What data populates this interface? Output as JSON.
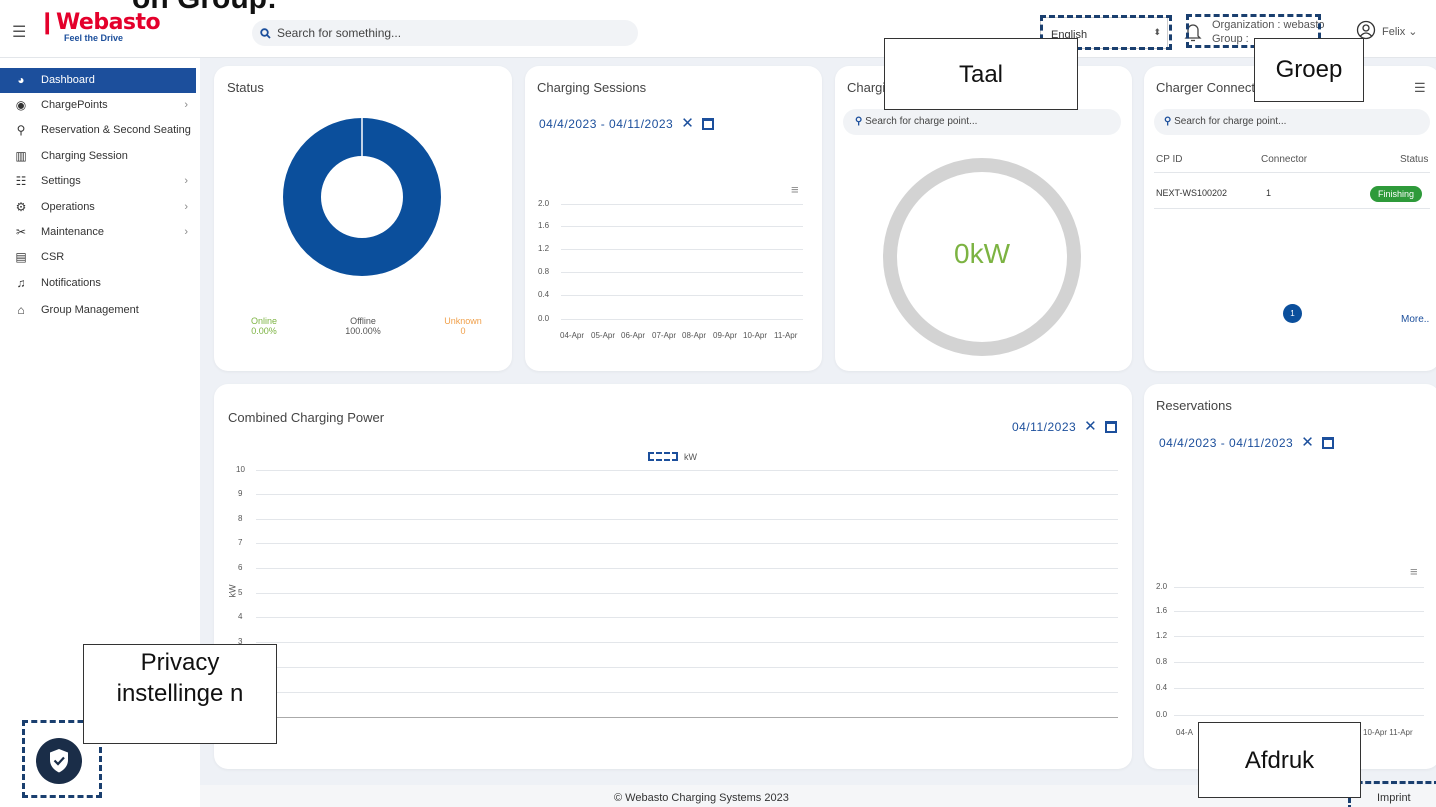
{
  "header": {
    "overlay_title": "on Group:",
    "logo_text": "Webasto",
    "logo_tagline": "Feel the Drive",
    "search_placeholder": "Search for something...",
    "language": "English",
    "organization": "Organization : webasto",
    "group": "Group : ",
    "user": "Felix"
  },
  "sidebar": {
    "items": [
      {
        "label": "Dashboard",
        "icon": "dashboard-icon",
        "active": true
      },
      {
        "label": "ChargePoints",
        "icon": "chargepoint-icon",
        "chevron": true
      },
      {
        "label": "Reservation & Second Seating",
        "icon": "reservation-icon"
      },
      {
        "label": "Charging Session",
        "icon": "charging-session-icon"
      },
      {
        "label": "Settings",
        "icon": "settings-icon",
        "chevron": true
      },
      {
        "label": "Operations",
        "icon": "operations-icon",
        "chevron": true
      },
      {
        "label": "Maintenance",
        "icon": "maintenance-icon",
        "chevron": true
      },
      {
        "label": "CSR",
        "icon": "csr-icon"
      },
      {
        "label": "Notifications",
        "icon": "bell-icon"
      },
      {
        "label": "Group Management",
        "icon": "home-icon"
      }
    ]
  },
  "status_card": {
    "title": "Status",
    "legend": [
      {
        "label": "Online",
        "value": "0.00%",
        "color": "#7cb342"
      },
      {
        "label": "Offline",
        "value": "100.00%",
        "color": "#555555"
      },
      {
        "label": "Unknown",
        "value": "0",
        "color": "#f0a04b"
      }
    ],
    "donut_color": "#0b4f9c",
    "offline_fraction": 1.0
  },
  "sessions_card": {
    "title": "Charging Sessions",
    "date_range": "04/4/2023 - 04/11/2023",
    "y_ticks": [
      "2.0",
      "1.6",
      "1.2",
      "0.8",
      "0.4",
      "0.0"
    ],
    "x_ticks": [
      "04-Apr",
      "05-Apr",
      "06-Apr",
      "07-Apr",
      "08-Apr",
      "09-Apr",
      "10-Apr",
      "11-Apr"
    ]
  },
  "power_card": {
    "title_visible": "Chargi",
    "search_placeholder": "Search for charge point...",
    "value": "0kW"
  },
  "connector_card": {
    "title_visible": "Charger Connect",
    "search_placeholder": "Search for charge point...",
    "columns": [
      "CP ID",
      "Connector",
      "Status"
    ],
    "rows": [
      {
        "cp_id": "NEXT-WS100202",
        "connector": "1",
        "status": "Finishing"
      }
    ],
    "page": "1",
    "more": "More.."
  },
  "combined_card": {
    "title": "Combined Charging Power",
    "date": "04/11/2023",
    "legend": "kW",
    "ylabel": "kW",
    "y_ticks": [
      "10",
      "9",
      "8",
      "7",
      "6",
      "5",
      "4",
      "3"
    ]
  },
  "reservations_card": {
    "title": "Reservations",
    "date_range": "04/4/2023 - 04/11/2023",
    "y_ticks": [
      "2.0",
      "1.6",
      "1.2",
      "0.8",
      "0.4",
      "0.0"
    ],
    "x_ticks": [
      "04-A",
      "10-Apr 11-Apr"
    ]
  },
  "annotations": {
    "taal": "Taal",
    "groep": "Groep",
    "privacy": "Privacy instellinge n",
    "afdruk": "Afdruk"
  },
  "footer": {
    "copyright": "© Webasto Charging Systems 2023",
    "imprint": "Imprint"
  }
}
